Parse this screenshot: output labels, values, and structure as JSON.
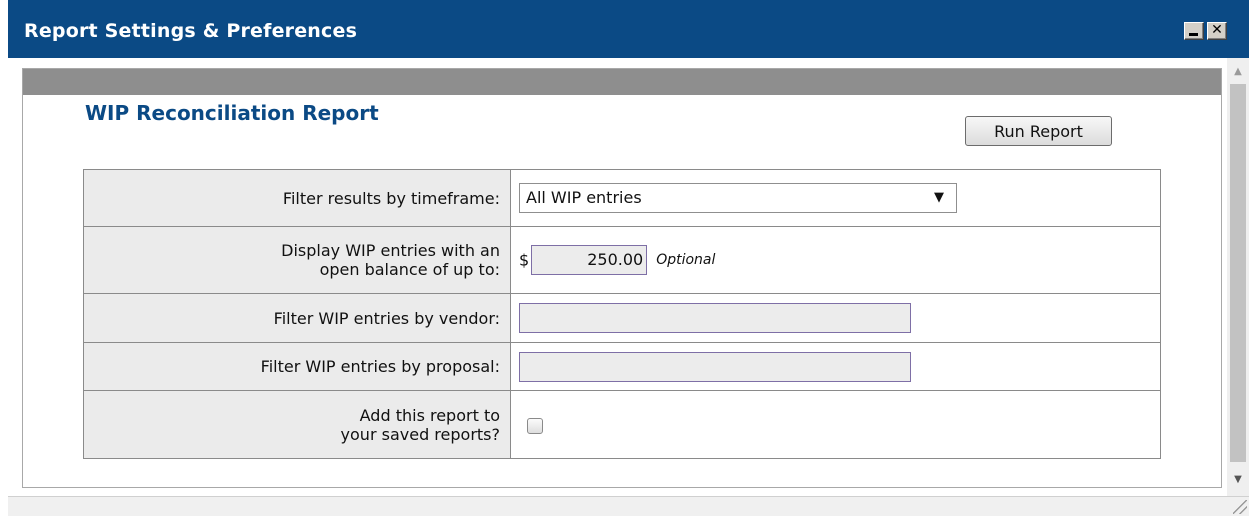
{
  "window": {
    "title": "Report Settings & Preferences",
    "minimize_icon": "minimize-icon",
    "close_glyph": "✕"
  },
  "report": {
    "title": "WIP Reconciliation Report",
    "run_button": "Run Report"
  },
  "form": {
    "timeframe_label": "Filter results by timeframe:",
    "timeframe_value": "All WIP entries",
    "balance_label_line1": "Display WIP entries with an",
    "balance_label_line2": "open balance of up to:",
    "currency_symbol": "$",
    "balance_value": "250.00",
    "optional_text": "Optional",
    "vendor_label": "Filter WIP entries by vendor:",
    "vendor_value": "",
    "proposal_label": "Filter WIP entries by proposal:",
    "proposal_value": "",
    "save_label_line1": "Add this report to",
    "save_label_line2": "your saved reports?",
    "save_checked": false
  },
  "colors": {
    "titlebar": "#0b4a85",
    "report_title": "#0b4a85",
    "header_band": "#8e8e8e"
  }
}
